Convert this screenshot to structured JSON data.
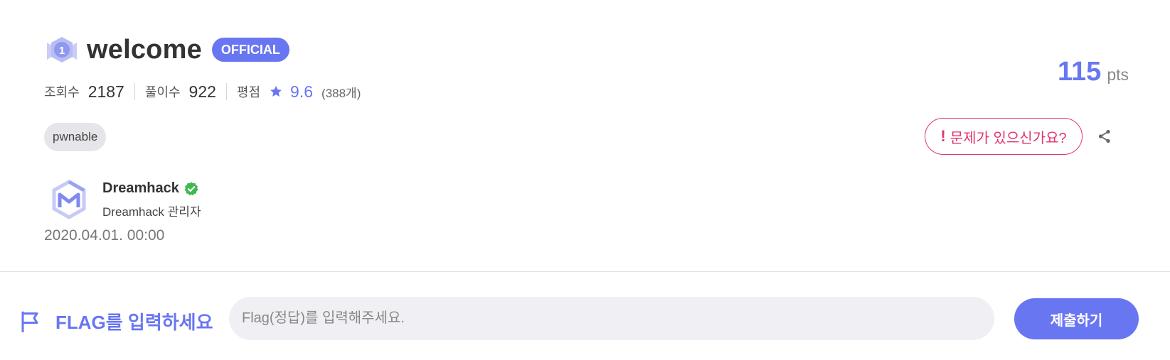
{
  "challenge": {
    "level_badge": "1",
    "title": "welcome",
    "official_badge": "OFFICIAL"
  },
  "stats": {
    "views_label": "조회수",
    "views_value": "2187",
    "solves_label": "풀이수",
    "solves_value": "922",
    "rating_label": "평점",
    "rating_value": "9.6",
    "rating_count": "(388개)"
  },
  "tags": [
    "pwnable"
  ],
  "author": {
    "name": "Dreamhack",
    "role": "Dreamhack 관리자"
  },
  "date": "2020.04.01. 00:00",
  "points": {
    "value": "115",
    "unit": "pts"
  },
  "report_button": {
    "icon": "!",
    "label": "문제가 있으신가요?"
  },
  "flag": {
    "label": "FLAG를 입력하세요",
    "placeholder": "Flag(정답)를 입력해주세요.",
    "value": "",
    "submit_label": "제출하기"
  },
  "icons": {
    "level": "level-badge-icon",
    "star": "star-icon",
    "verified": "verified-check-icon",
    "share": "share-icon",
    "flag": "flag-icon",
    "logo": "dreamhack-logo"
  },
  "colors": {
    "accent": "#6976f2",
    "alert": "#e0336f",
    "verified": "#3fb950",
    "muted": "#777777"
  }
}
